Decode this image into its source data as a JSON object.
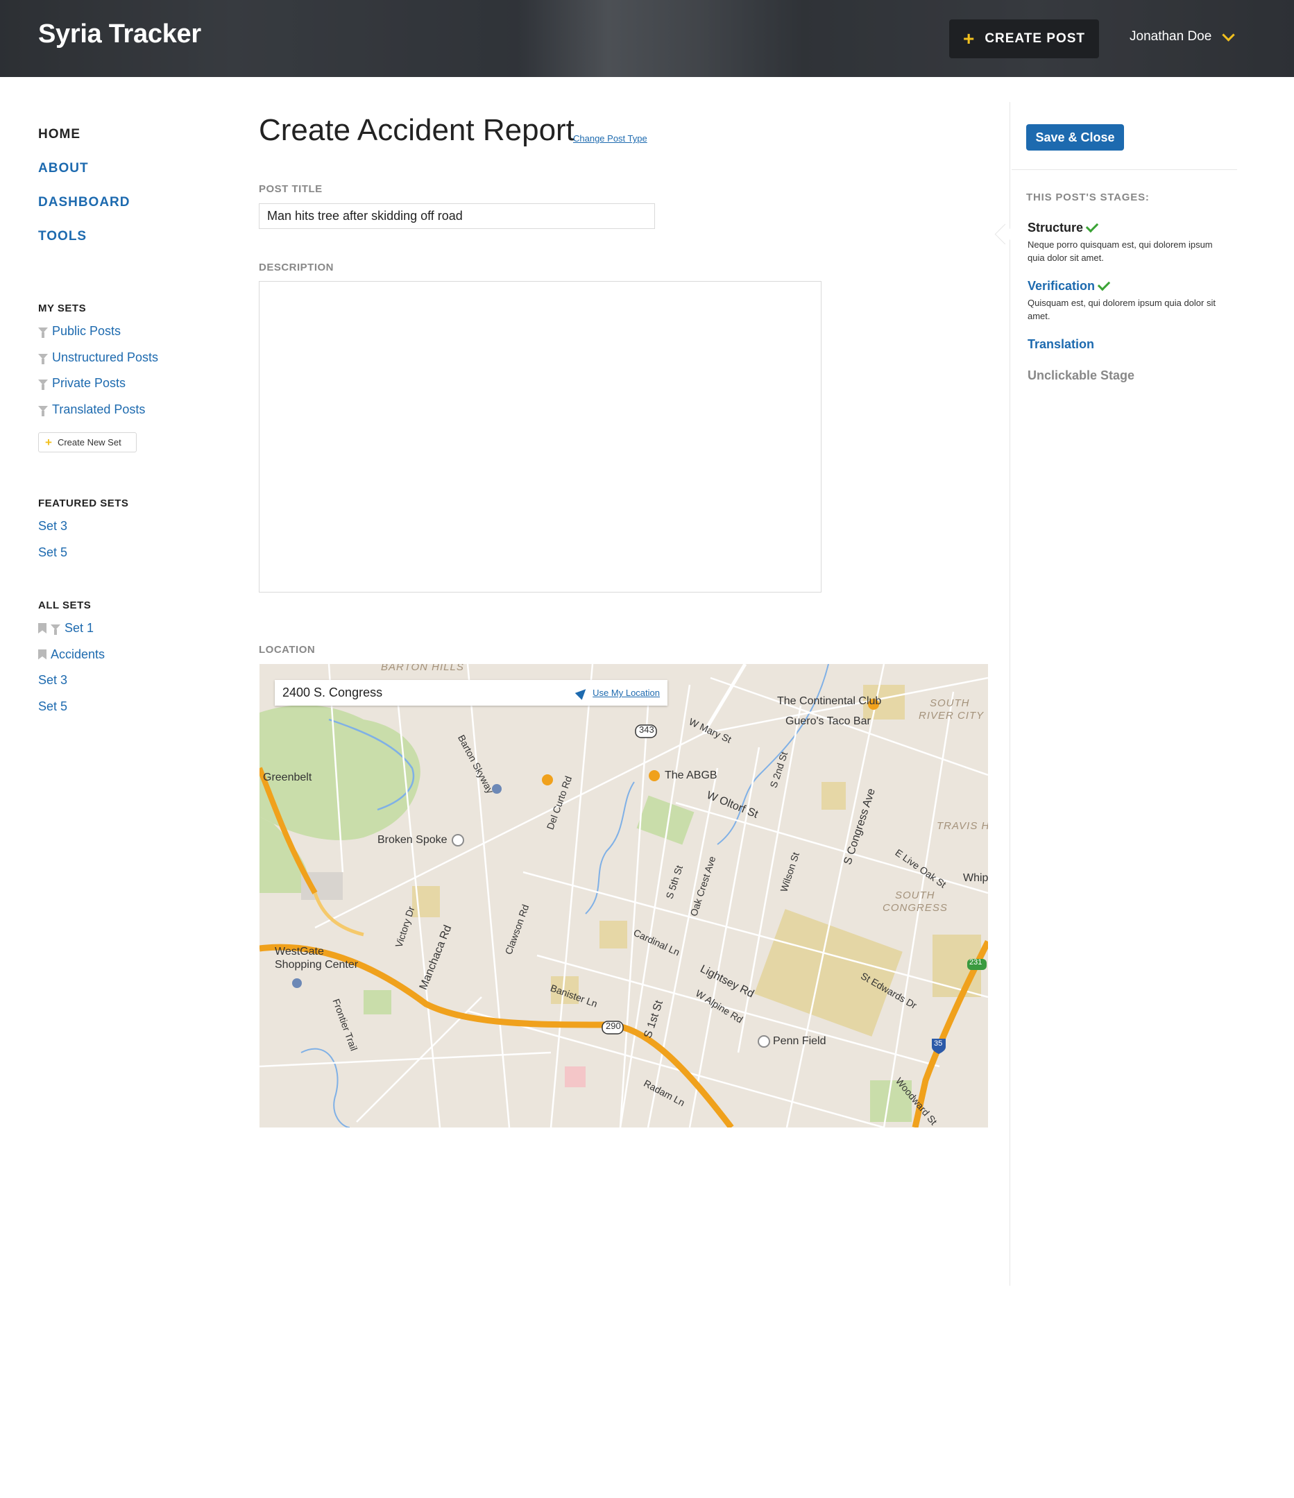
{
  "header": {
    "brand": "Syria Tracker",
    "create_post_label": "CREATE POST",
    "user_name": "Jonathan Doe"
  },
  "nav": {
    "home": "HOME",
    "about": "ABOUT",
    "dashboard": "DASHBOARD",
    "tools": "TOOLS"
  },
  "my_sets": {
    "title": "MY SETS",
    "items": [
      "Public Posts",
      "Unstructured Posts",
      "Private Posts",
      "Translated Posts"
    ],
    "create_label": "Create New Set"
  },
  "featured_sets": {
    "title": "FEATURED SETS",
    "items": [
      "Set 3",
      "Set 5"
    ]
  },
  "all_sets": {
    "title": "ALL SETS",
    "items": [
      "Set 1",
      "Accidents",
      "Set 3",
      "Set 5"
    ]
  },
  "main": {
    "page_title": "Create Accident Report",
    "change_post_type": "Change Post Type",
    "post_title_label": "POST TITLE",
    "post_title_value": "Man hits tree after skidding off road",
    "description_label": "DESCRIPTION",
    "description_value": "",
    "location_label": "LOCATION",
    "location_value": "2400 S. Congress",
    "use_my_location": "Use My Location"
  },
  "map_labels": {
    "barton_hills": "BARTON HILLS",
    "continental": "The Continental Club",
    "gueros": "Guero's Taco Bar",
    "south_river_city": "SOUTH",
    "south_river_city2": "RIVER CITY",
    "abgb": "The ABGB",
    "greenbelt": "Greenbelt",
    "broken_spoke": "Broken Spoke",
    "w_oltorf": "W Oltorf St",
    "travis": "TRAVIS H",
    "whip": "Whip",
    "south_congress": "SOUTH",
    "south_congress2": "CONGRESS",
    "westgate": "WestGate",
    "westgate2": "Shopping Center",
    "penn_field": "Penn Field",
    "manchaca": "Manchaca Rd",
    "lightsey": "Lightsey Rd",
    "s_congress_ave": "S Congress Ave",
    "s_1st": "S 1st St",
    "st_edwards": "St Edwards Dr",
    "woodward": "Woodward St",
    "banister": "Banister Ln",
    "cardinal": "Cardinal Ln",
    "w_alpine": "W Alpine Rd",
    "radam": "Radam Ln",
    "clawson": "Clawson Rd",
    "victory": "Victory Dr",
    "frontier": "Frontier Trail",
    "del_curto": "Del Curto Rd",
    "barton_skyway": "Barton Skyway",
    "oak_crest": "Oak Crest Ave",
    "wilson": "Wilson St",
    "s_5th": "S 5th St",
    "s_2nd": "S 2nd St",
    "e_live_oak": "E Live Oak St",
    "w_mary": "W Mary St",
    "hwy_343": "343",
    "hwy_290": "290",
    "hwy_35": "35",
    "hwy_231": "231"
  },
  "right_panel": {
    "save_close": "Save & Close",
    "stages_title": "THIS POST'S STAGES:",
    "stages": [
      {
        "name": "Structure",
        "desc": "Neque porro quisquam est, qui dolorem ipsum quia dolor sit amet.",
        "complete": true,
        "color": "#222222"
      },
      {
        "name": "Verification",
        "desc": "Quisquam est, qui dolorem ipsum quia dolor sit amet.",
        "complete": true,
        "color": "#1d6aaf"
      },
      {
        "name": "Translation",
        "desc": "",
        "complete": false,
        "color": "#1d6aaf"
      },
      {
        "name": "Unclickable Stage",
        "desc": "",
        "complete": false,
        "color": "#888888"
      }
    ]
  },
  "colors": {
    "accent_blue": "#1d6aaf",
    "accent_yellow": "#f2c01e",
    "check_green": "#3aa335",
    "highway_orange": "#f0a11c"
  }
}
